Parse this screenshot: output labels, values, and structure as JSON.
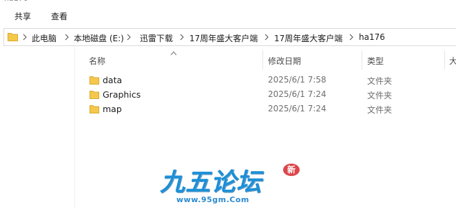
{
  "window": {
    "title_fragment": "ha176"
  },
  "ribbon": {
    "tabs": [
      {
        "label": "共享"
      },
      {
        "label": "查看"
      }
    ]
  },
  "address_bar": {
    "breadcrumbs": [
      "此电脑",
      "本地磁盘 (E:)",
      "迅雷下载",
      "17周年盛大客户端",
      "17周年盛大客户端",
      "ha176"
    ]
  },
  "file_list": {
    "columns": [
      {
        "label": "名称"
      },
      {
        "label": "修改日期"
      },
      {
        "label": "类型"
      },
      {
        "label": "大"
      }
    ],
    "sorted_by": "名称",
    "rows": [
      {
        "name": "data",
        "modified": "2025/6/1 7:58",
        "type": "文件夹",
        "icon": "folder-icon"
      },
      {
        "name": "Graphics",
        "modified": "2025/6/1 7:24",
        "type": "文件夹",
        "icon": "folder-icon"
      },
      {
        "name": "map",
        "modified": "2025/6/1 7:24",
        "type": "文件夹",
        "icon": "folder-icon"
      }
    ]
  },
  "watermark": {
    "logo_text": "九五论坛",
    "url": "www.95gm.Com",
    "seal_text": "新"
  },
  "colors": {
    "folder": "#f4c84a",
    "folder_dark": "#d9a82a",
    "watermark_blue": "#1c8fd6",
    "seal_red": "#d6262b"
  }
}
